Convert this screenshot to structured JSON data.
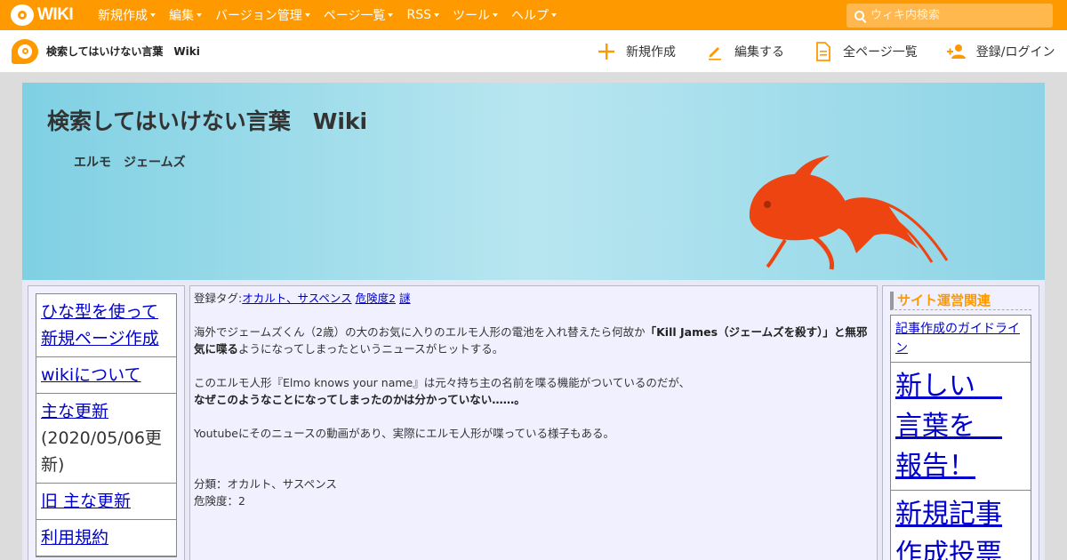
{
  "topbar": {
    "logo_text": "WIKI",
    "menu": [
      {
        "label": "新規作成"
      },
      {
        "label": "編集"
      },
      {
        "label": "バージョン管理"
      },
      {
        "label": "ページ一覧"
      },
      {
        "label": "RSS"
      },
      {
        "label": "ツール"
      },
      {
        "label": "ヘルプ"
      }
    ],
    "search_placeholder": "ウィキ内検索"
  },
  "subbar": {
    "site_name": "検索してはいけない言葉　Wiki",
    "actions": [
      {
        "label": "新規作成",
        "icon": "plus-icon"
      },
      {
        "label": "編集する",
        "icon": "pencil-icon"
      },
      {
        "label": "全ページ一覧",
        "icon": "page-list-icon"
      },
      {
        "label": "登録/ログイン",
        "icon": "users-icon"
      }
    ]
  },
  "banner": {
    "title": "検索してはいけない言葉　Wiki",
    "subtitle": "エルモ　ジェームズ"
  },
  "left_nav": {
    "items": [
      {
        "label": "ひな型を使って新規ページ作成"
      },
      {
        "label": "wikiについて"
      },
      {
        "label": "主な更新",
        "note": "(2020/05/06更新)"
      },
      {
        "label": "旧 主な更新"
      },
      {
        "label": "利用規約"
      }
    ]
  },
  "main": {
    "tags_prefix": "登録タグ:",
    "tags": [
      "オカルト、サスペンス",
      "危険度2",
      "謎"
    ],
    "para1_normal": "海外でジェームズくん（2歳）の大のお気に入りのエルモ人形の電池を入れ替えたら何故か",
    "para1_bold": "「Kill James（ジェームズを殺す）」と無邪気に喋る",
    "para1_tail": "ようになってしまったというニュースがヒットする。",
    "para2_line1": "このエルモ人形『Elmo knows your name』は元々持ち主の名前を喋る機能がついているのだが、",
    "para2_bold": "なぜこのようなことになってしまったのかは分かっていない……。",
    "para3": "Youtubeにそのニュースの動画があり、実際にエルモ人形が喋っている様子もある。",
    "category": "分類：オカルト、サスペンス",
    "danger": "危険度：2"
  },
  "right_nav": {
    "title": "サイト運営関連",
    "items": [
      {
        "label": "記事作成のガイドライン",
        "size": "small"
      },
      {
        "label": "新しい　言葉を　報告！",
        "size": "big"
      },
      {
        "label": "新規記事作成投票",
        "size": "big"
      }
    ]
  },
  "colors": {
    "brand_orange": "#ff9900",
    "link_blue": "#0000cc",
    "fish": "#ee4411"
  }
}
